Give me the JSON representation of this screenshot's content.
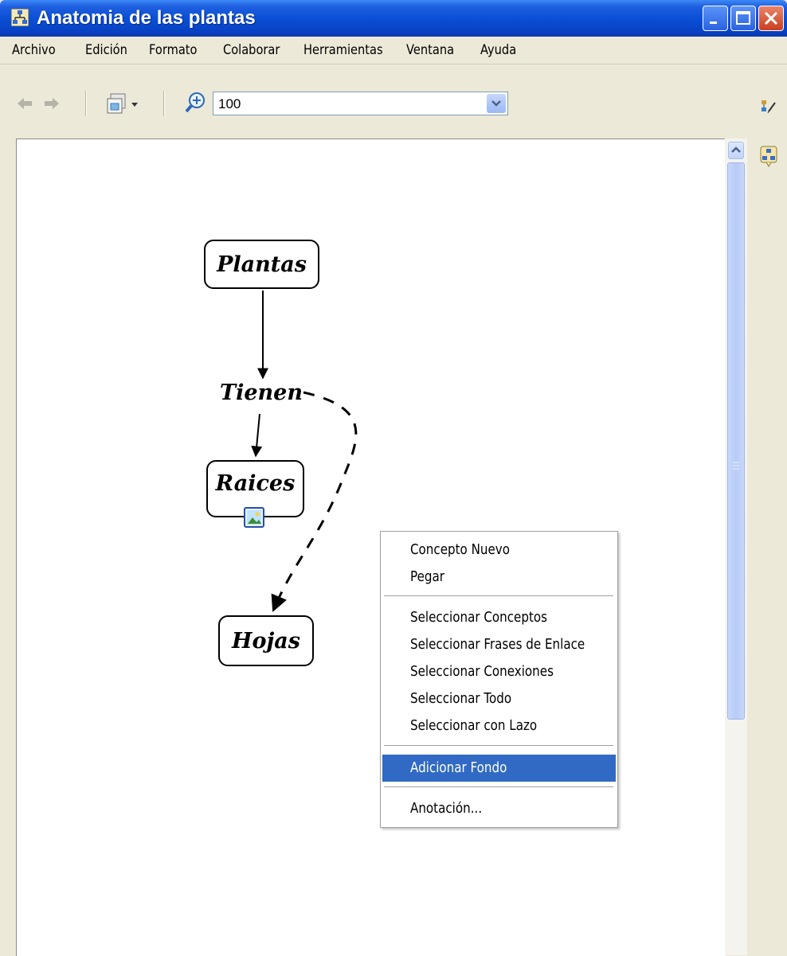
{
  "window": {
    "title": "Anatomia de las plantas"
  },
  "menu": [
    "Archivo",
    "Edición",
    "Formato",
    "Colaborar",
    "Herramientas",
    "Ventana",
    "Ayuda"
  ],
  "toolbar": {
    "zoom_value": "100",
    "icons": [
      "back-arrow-icon",
      "forward-arrow-icon",
      "view-icon",
      "zoom-icon",
      "edit-icon",
      "map-icon"
    ]
  },
  "concept_map": {
    "concepts": [
      "Plantas",
      "Raices",
      "Hojas"
    ],
    "linking_phrases": [
      "Tienen"
    ]
  },
  "context_menu": {
    "items": [
      "Concepto Nuevo",
      "Pegar",
      "Seleccionar Conceptos",
      "Seleccionar Frases de Enlace",
      "Seleccionar Conexiones",
      "Seleccionar Todo",
      "Seleccionar con Lazo",
      "Adicionar Fondo",
      "Anotación..."
    ],
    "selected": "Adicionar Fondo"
  },
  "colors": {
    "titlebar": "#0a4fd6",
    "selection": "#316ac5",
    "chrome": "#ece9d8"
  }
}
